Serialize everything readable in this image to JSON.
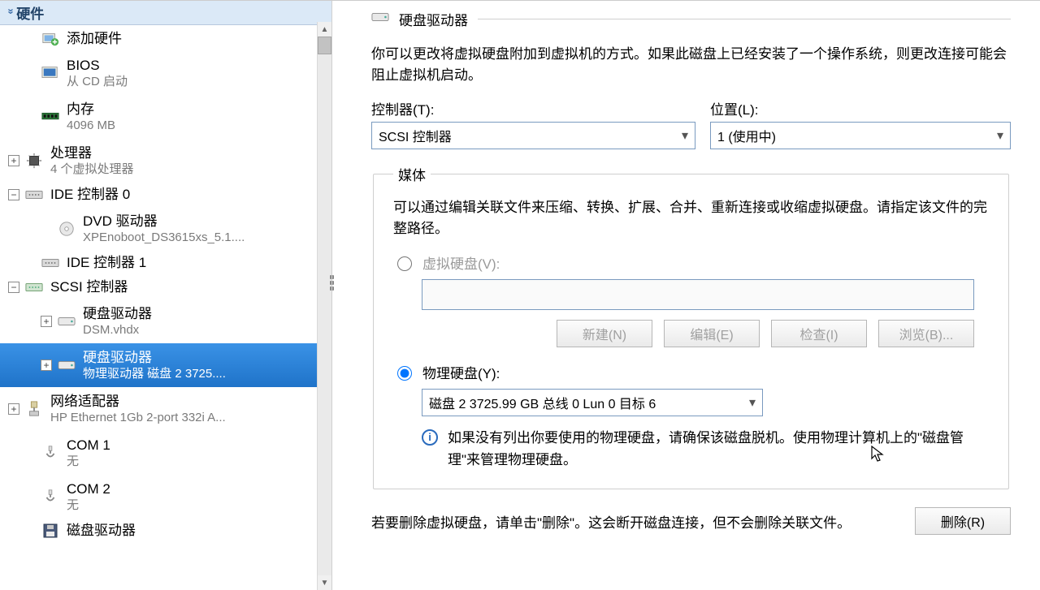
{
  "sidebar": {
    "header": "硬件",
    "items": [
      {
        "title": "添加硬件",
        "subtitle": "",
        "twoLine": false,
        "expander": "",
        "icon": "add-hw",
        "name": "add-hardware"
      },
      {
        "title": "BIOS",
        "subtitle": "从 CD 启动",
        "twoLine": true,
        "expander": "",
        "icon": "bios",
        "name": "bios"
      },
      {
        "title": "内存",
        "subtitle": "4096 MB",
        "twoLine": true,
        "expander": "",
        "icon": "memory",
        "name": "memory"
      },
      {
        "title": "处理器",
        "subtitle": "4 个虚拟处理器",
        "twoLine": true,
        "expander": "+",
        "icon": "cpu",
        "name": "processor"
      },
      {
        "title": "IDE 控制器 0",
        "subtitle": "",
        "twoLine": false,
        "expander": "-",
        "icon": "ide",
        "name": "ide-controller-0"
      },
      {
        "title": "DVD 驱动器",
        "subtitle": "XPEnoboot_DS3615xs_5.1....",
        "twoLine": true,
        "expander": "",
        "icon": "dvd",
        "indent": "sub2",
        "name": "dvd-drive"
      },
      {
        "title": "IDE 控制器 1",
        "subtitle": "",
        "twoLine": false,
        "expander": "",
        "icon": "ide",
        "name": "ide-controller-1"
      },
      {
        "title": "SCSI 控制器",
        "subtitle": "",
        "twoLine": false,
        "expander": "-",
        "icon": "scsi",
        "name": "scsi-controller"
      },
      {
        "title": "硬盘驱动器",
        "subtitle": "DSM.vhdx",
        "twoLine": true,
        "expander": "+",
        "icon": "hdd",
        "indent": "sub2",
        "name": "hard-disk-1"
      },
      {
        "title": "硬盘驱动器",
        "subtitle": "物理驱动器 磁盘 2 3725....",
        "twoLine": true,
        "expander": "+",
        "icon": "hdd",
        "indent": "sub2",
        "selected": true,
        "name": "hard-disk-2"
      },
      {
        "title": "网络适配器",
        "subtitle": "HP Ethernet 1Gb 2-port 332i A...",
        "twoLine": true,
        "expander": "+",
        "icon": "nic",
        "name": "network-adapter"
      },
      {
        "title": "COM 1",
        "subtitle": "无",
        "twoLine": true,
        "expander": "",
        "icon": "com",
        "name": "com-1"
      },
      {
        "title": "COM 2",
        "subtitle": "无",
        "twoLine": true,
        "expander": "",
        "icon": "com",
        "name": "com-2"
      },
      {
        "title": "磁盘驱动器",
        "subtitle": "",
        "twoLine": false,
        "expander": "",
        "icon": "floppy",
        "name": "diskette-drive"
      }
    ]
  },
  "main": {
    "section_title": "硬盘驱动器",
    "desc": "你可以更改将虚拟硬盘附加到虚拟机的方式。如果此磁盘上已经安装了一个操作系统，则更改连接可能会阻止虚拟机启动。",
    "controller_label": "控制器(T):",
    "controller_value": "SCSI 控制器",
    "location_label": "位置(L):",
    "location_value": "1 (使用中)",
    "media_legend": "媒体",
    "media_desc": "可以通过编辑关联文件来压缩、转换、扩展、合并、重新连接或收缩虚拟硬盘。请指定该文件的完整路径。",
    "radio_vhd": "虚拟硬盘(V):",
    "btn_new": "新建(N)",
    "btn_edit": "编辑(E)",
    "btn_inspect": "检查(I)",
    "btn_browse": "浏览(B)...",
    "radio_physical": "物理硬盘(Y):",
    "physical_value": "磁盘 2 3725.99 GB 总线 0 Lun 0 目标 6",
    "info_text": "如果没有列出你要使用的物理硬盘，请确保该磁盘脱机。使用物理计算机上的\"磁盘管理\"来管理物理硬盘。",
    "delete_desc": "若要删除虚拟硬盘，请单击\"删除\"。这会断开磁盘连接，但不会删除关联文件。",
    "btn_delete": "删除(R)"
  }
}
